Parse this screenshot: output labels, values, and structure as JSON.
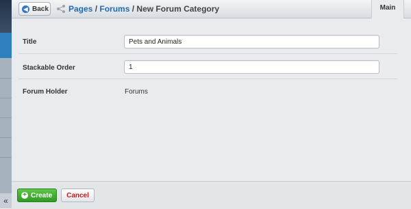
{
  "header": {
    "back_label": "Back",
    "breadcrumb": {
      "pages": "Pages",
      "sep1": " / ",
      "forums": "Forums",
      "sep2": " / ",
      "current": "New Forum Category"
    },
    "tab_main": "Main"
  },
  "form": {
    "title_label": "Title",
    "title_value": "Pets and Animals",
    "order_label": "Stackable Order",
    "order_value": "1",
    "holder_label": "Forum Holder",
    "holder_value": "Forums"
  },
  "footer": {
    "create_label": "Create",
    "cancel_label": "Cancel"
  },
  "rail": {
    "collapse_glyph": "«"
  },
  "colors": {
    "link": "#1f6cb3",
    "create": "#2f9a22",
    "cancel_text": "#c51a1a",
    "rail_active": "#2d7fc0"
  },
  "icons": [
    "back-arrow-icon",
    "share-icon",
    "plus-icon",
    "collapse-icon"
  ]
}
